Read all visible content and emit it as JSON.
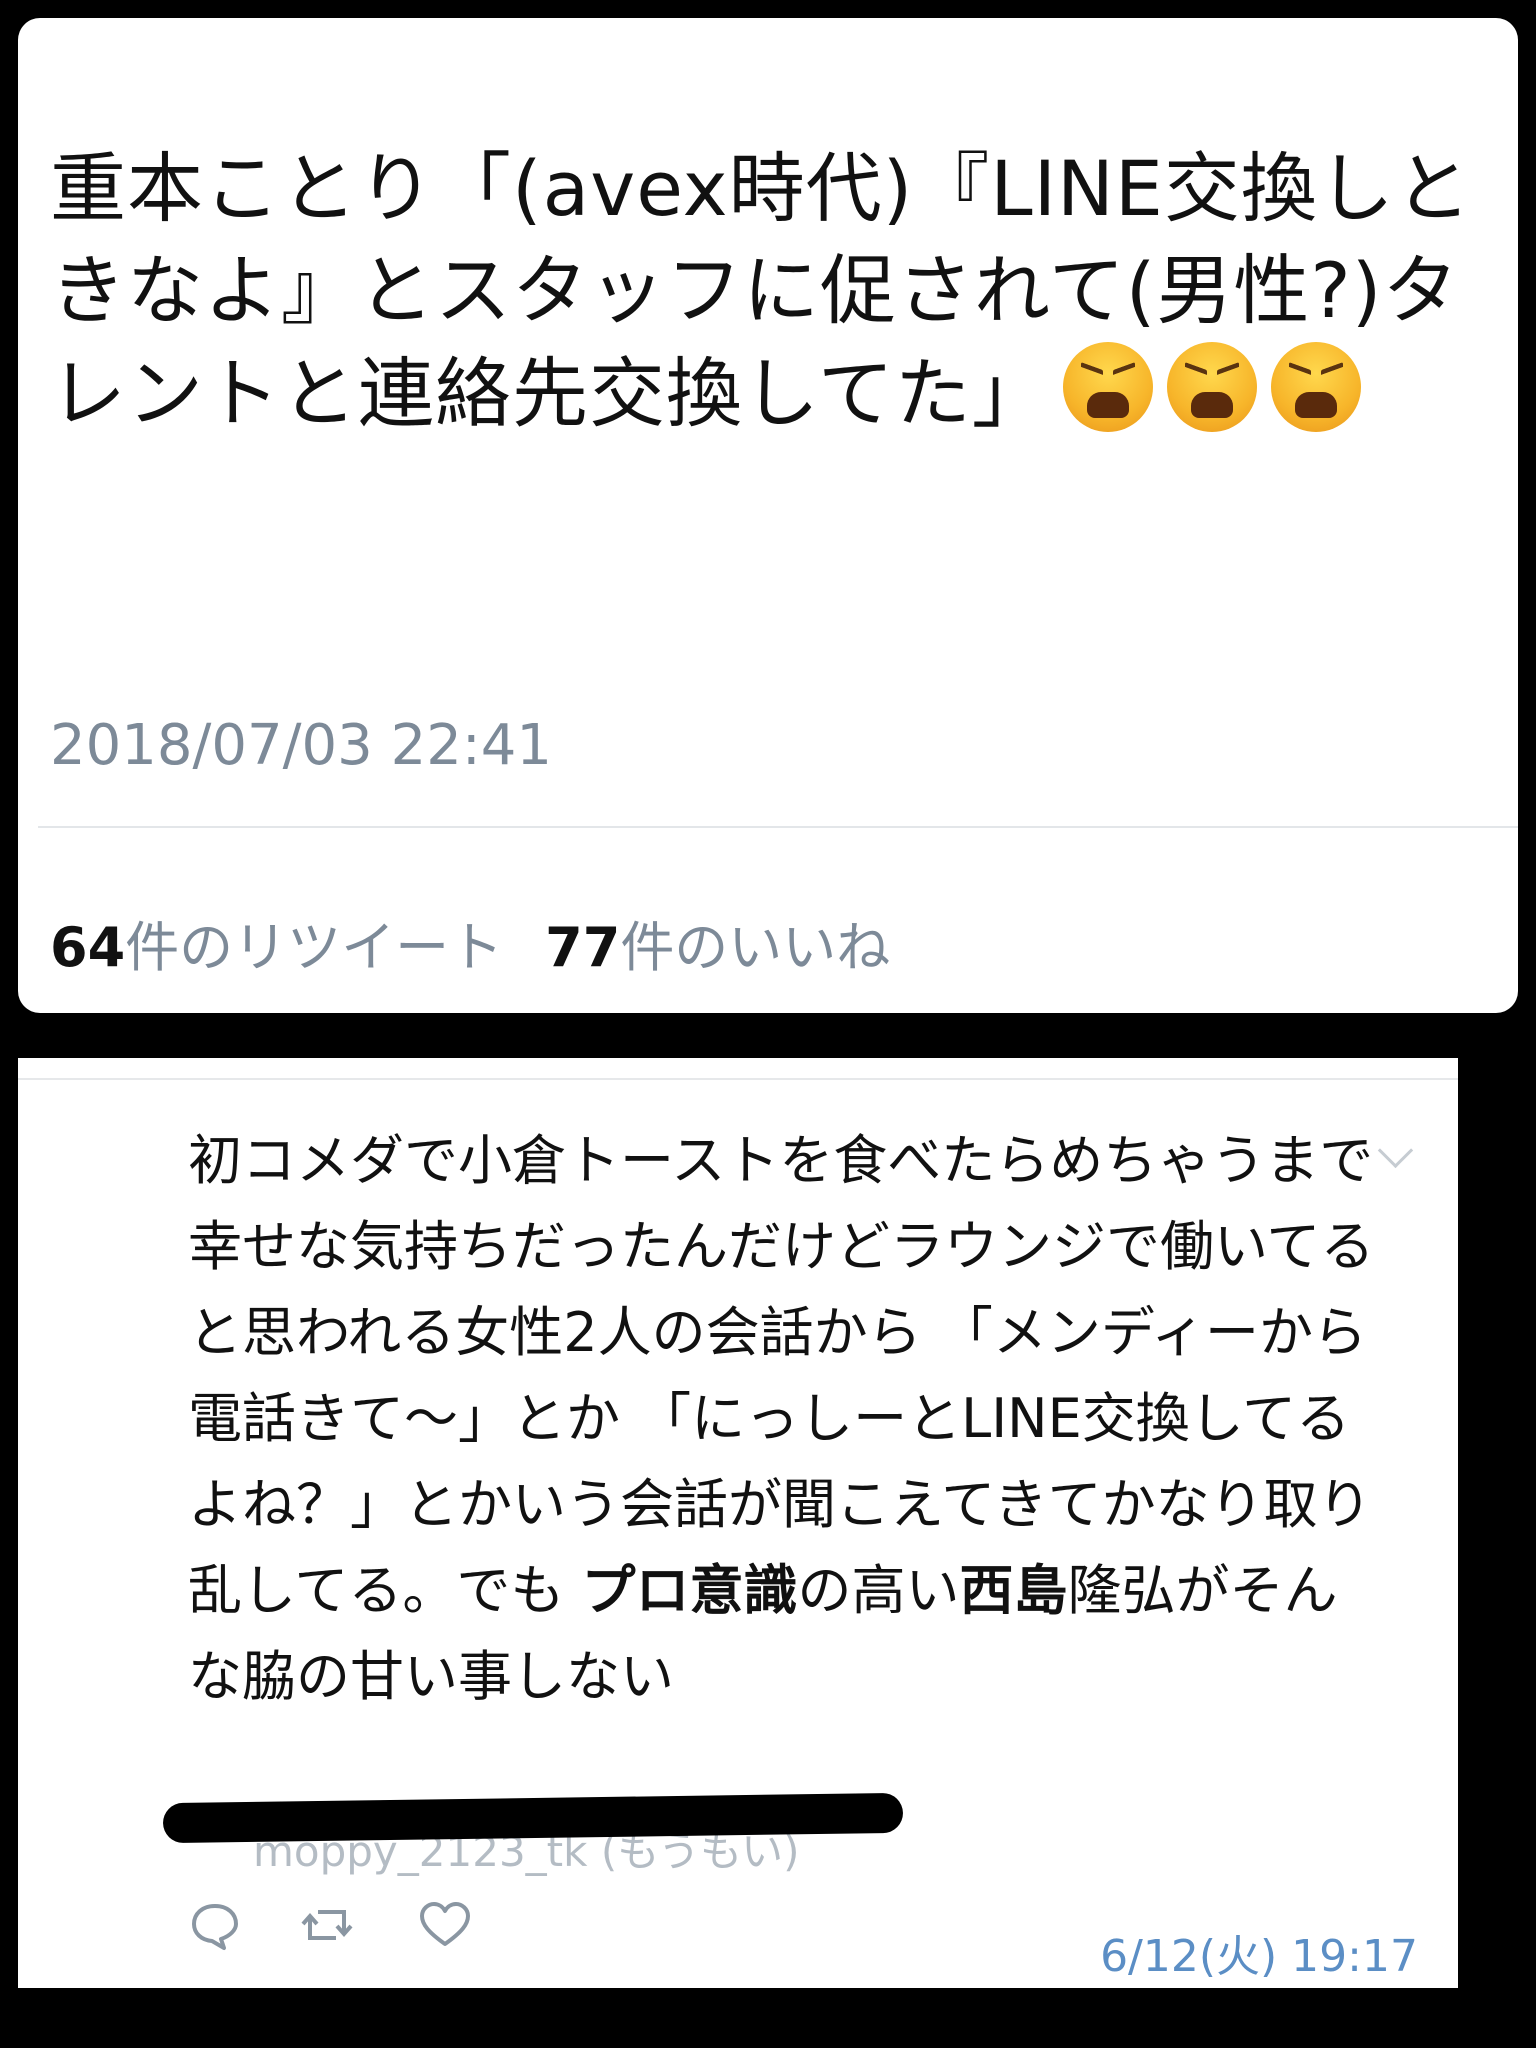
{
  "tweet": {
    "text": "重本ことり「(avex時代)『LINE交換しときなよ』とスタッフに促されて(男性?)タレントと連絡先交換してた」",
    "emojis": [
      "tired-face-emoji",
      "tired-face-emoji",
      "tired-face-emoji"
    ],
    "timestamp": "2018/07/03 22:41",
    "retweet_count": "64",
    "retweet_label": "件のリツイート",
    "like_count": "77",
    "like_label": "件のいいね"
  },
  "reply": {
    "text_part1": "初コメダで小倉トーストを食べたらめちゃうまで幸せな気持ちだったんだけどラウンジで働いてると思われる女性2人の会話から 「メンディーから電話きて〜」とか 「にっしーとLINE交換してるよね？」とかいう会話が聞こえてきてかなり取り乱してる。でも ",
    "bold1": "プロ意識",
    "text_part2": "の高い",
    "bold2": "西島",
    "text_part3": "隆弘がそんな脇の甘い事しない",
    "handle_partial": "moppy_2123_tk (もうもい)",
    "timestamp": "6/12(火) 19:17",
    "icons": [
      "reply-icon",
      "retweet-icon",
      "like-icon"
    ]
  }
}
